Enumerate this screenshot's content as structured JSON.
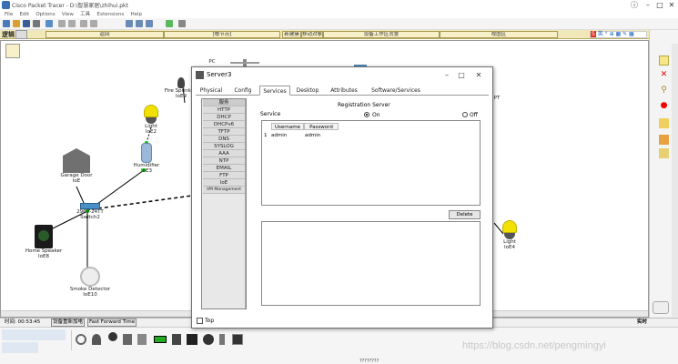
{
  "app": {
    "title": "Cisco Packet Tracer - D:\\智慧家居\\zhihui.pkt",
    "menus": [
      "File",
      "Edit",
      "Options",
      "View",
      "工具",
      "Extensions",
      "Help"
    ]
  },
  "logical_bar": {
    "label": "逻辑",
    "segments": [
      "返回",
      "[根节点]",
      "新建簇",
      "移动对象",
      "设备工作区背景",
      "视图区"
    ]
  },
  "ime": {
    "label": "英"
  },
  "devices": [
    {
      "id": "fire",
      "label": "Fire Sprinkler",
      "sub": "IoE9"
    },
    {
      "id": "light2",
      "label": "Light",
      "sub": "IoE2"
    },
    {
      "id": "humid",
      "label": "Humidifier",
      "sub": "IoE3"
    },
    {
      "id": "garage",
      "label": "Garage Door",
      "sub": "IoE"
    },
    {
      "id": "switch",
      "label": "Switch2",
      "sub": "2960-24TT"
    },
    {
      "id": "speaker",
      "label": "Home Speaker",
      "sub": "IoE8"
    },
    {
      "id": "smoke",
      "label": "Smoke Detector",
      "sub": "IoE10"
    },
    {
      "id": "light4",
      "label": "Light",
      "sub": "IoE4"
    },
    {
      "id": "pc",
      "label": "PC"
    },
    {
      "id": "pt",
      "label": "PT"
    }
  ],
  "status": {
    "time_label": "时间: 00:53:45",
    "power_btn": "设备重新加电",
    "fast_forward": "Fast Forward Time",
    "realtime": "实时"
  },
  "dialog": {
    "title": "Server3",
    "tabs": [
      "Physical",
      "Config",
      "Services",
      "Desktop",
      "Attributes",
      "Software/Services"
    ],
    "active_tab": "Services",
    "services": [
      "服务",
      "HTTP",
      "DHCP",
      "DHCPv6",
      "TFTP",
      "DNS",
      "SYSLOG",
      "AAA",
      "NTP",
      "EMAIL",
      "FTP",
      "IoE",
      "VM Management"
    ],
    "section_title": "Registration Server",
    "service_label": "Service",
    "on_label": "On",
    "off_label": "Off",
    "table": {
      "headers": [
        "Username",
        "Password"
      ],
      "rows": [
        {
          "index": "1",
          "username": "admin",
          "password": "admin"
        }
      ]
    },
    "delete_label": "Delete",
    "top_label": "Top"
  },
  "watermark": "https://blog.csdn.net/pengmingyi",
  "bottom_label": "????????",
  "colors": {
    "logic_bar": "#f0e8b8",
    "light_yellow": "#f2e100",
    "link_green": "#00c000"
  }
}
